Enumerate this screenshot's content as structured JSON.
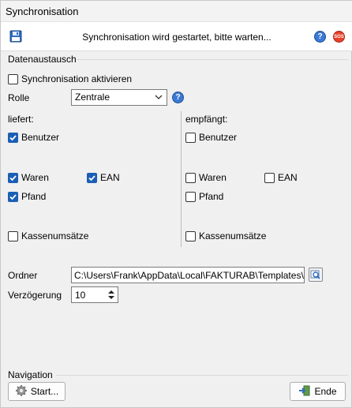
{
  "window": {
    "title": "Synchronisation"
  },
  "header": {
    "status_text": "Synchronisation wird gestartet, bitte warten..."
  },
  "datenaustausch": {
    "group_title": "Datenaustausch",
    "sync_activate": {
      "label": "Synchronisation aktivieren",
      "checked": false
    },
    "rolle": {
      "label": "Rolle",
      "value": "Zentrale"
    },
    "liefert": {
      "header": "liefert:",
      "benutzer": {
        "label": "Benutzer",
        "checked": true
      },
      "waren": {
        "label": "Waren",
        "checked": true
      },
      "ean": {
        "label": "EAN",
        "checked": true
      },
      "pfand": {
        "label": "Pfand",
        "checked": true
      },
      "kassenumsaetze": {
        "label": "Kassenumsätze",
        "checked": false
      }
    },
    "empfaengt": {
      "header": "empfängt:",
      "benutzer": {
        "label": "Benutzer",
        "checked": false
      },
      "waren": {
        "label": "Waren",
        "checked": false
      },
      "ean": {
        "label": "EAN",
        "checked": false
      },
      "pfand": {
        "label": "Pfand",
        "checked": false
      },
      "kassenumsaetze": {
        "label": "Kassenumsätze",
        "checked": false
      }
    },
    "ordner": {
      "label": "Ordner",
      "value": "C:\\Users\\Frank\\AppData\\Local\\FAKTURAB\\Templates\\Syn"
    },
    "verzoegerung": {
      "label": "Verzögerung",
      "value": "10"
    }
  },
  "navigation": {
    "group_title": "Navigation",
    "start_label": "Start...",
    "ende_label": "Ende"
  },
  "icons": {
    "save": "save-icon",
    "help": "help-icon",
    "sos": "sos-icon",
    "browse": "browse-folder-icon",
    "start": "gear-icon",
    "ende": "exit-icon"
  },
  "colors": {
    "check_accent": "#1a5fb4",
    "help_blue": "#3b7ad4",
    "sos_red": "#e8402a"
  }
}
